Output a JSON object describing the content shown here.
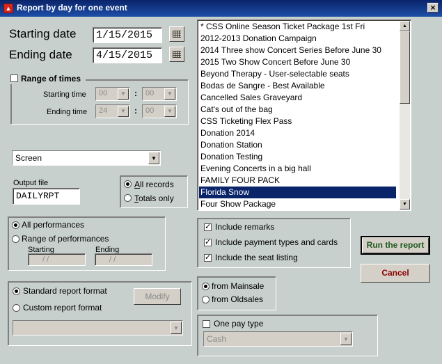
{
  "window": {
    "title": "Report by day for one event",
    "close_label": "×"
  },
  "dates": {
    "starting_label": "Starting date",
    "starting_value": "1/15/2015",
    "ending_label": "Ending date",
    "ending_value": "4/15/2015"
  },
  "times": {
    "range_label": "Range of times",
    "range_checked": false,
    "starting_label": "Starting time",
    "starting_hour": "00",
    "starting_min": "00",
    "ending_label": "Ending time",
    "ending_hour": "24",
    "ending_min": "00",
    "separator": ":"
  },
  "output": {
    "destination": "Screen",
    "file_label": "Output file",
    "file_value": "DAILYRPT"
  },
  "records": {
    "all_label": "All records",
    "totals_label": "Totals only",
    "selected": "all"
  },
  "events": {
    "items": [
      "* CSS Online Season Ticket Package 1st Fri",
      "2012-2013 Donation Campaign",
      "2014 Three show Concert Series Before June 30",
      "2015 Two Show Concert Before June 30",
      "Beyond Therapy - User-selectable seats",
      "Bodas de Sangre - Best Available",
      "Cancelled Sales Graveyard",
      "Cat's out of the bag",
      "CSS Ticketing Flex Pass",
      "Donation 2014",
      "Donation Station",
      "Donation Testing",
      "Evening Concerts in a big hall",
      "FAMILY FOUR PACK",
      "Florida Snow",
      "Four Show Package"
    ],
    "selected": "Florida Snow"
  },
  "performances": {
    "all_label": "All performances",
    "range_label": "Range of performances",
    "starting_label": "Starting",
    "ending_label": "Ending",
    "starting_value": "/ /",
    "ending_value": "/ /",
    "selected": "all"
  },
  "includes": {
    "remarks_label": "Include remarks",
    "payment_label": "Include payment types and cards",
    "seat_label": "Include the seat listing",
    "remarks_checked": true,
    "payment_checked": true,
    "seat_checked": true
  },
  "buttons": {
    "run_label": "Run the report",
    "cancel_label": "Cancel",
    "modify_label": "Modify"
  },
  "format": {
    "standard_label": "Standard report format",
    "custom_label": "Custom report format",
    "selected": "standard",
    "custom_value": ""
  },
  "source": {
    "mainsale_label": "from Mainsale",
    "oldsales_label": "from Oldsales",
    "selected": "mainsale"
  },
  "paytype": {
    "one_label": "One pay type",
    "checked": false,
    "value": "Cash"
  },
  "icons": {
    "calendar": "calendar-icon",
    "dropdown": "chevron-down-icon",
    "app": "app-icon"
  },
  "colors": {
    "titlebar": "#0a246a",
    "background": "#c7d0cc",
    "selection": "#0a246a",
    "run_text": "#1f5a1f",
    "cancel_text": "#8b0000"
  }
}
